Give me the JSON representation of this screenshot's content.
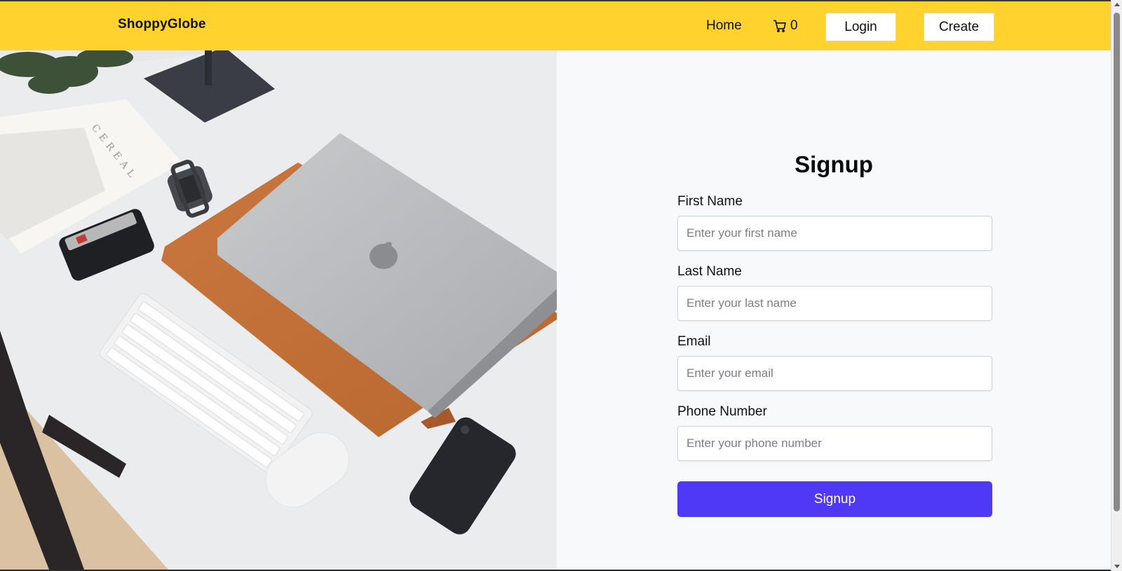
{
  "navbar": {
    "brand": "ShoppyGlobe",
    "home": "Home",
    "cart_count": "0",
    "cart_icon": "cart-icon",
    "login": "Login",
    "create": "Create",
    "background_color": "#ffd22e"
  },
  "hero": {
    "image_alt": "Desk with laptop, keyboard, mouse, phone, watch and wallet"
  },
  "form": {
    "title": "Signup",
    "fields": [
      {
        "label": "First Name",
        "placeholder": "Enter your first name"
      },
      {
        "label": "Last Name",
        "placeholder": "Enter your last name"
      },
      {
        "label": "Email",
        "placeholder": "Enter your email"
      },
      {
        "label": "Phone Number",
        "placeholder": "Enter your phone number"
      }
    ],
    "submit": "Signup",
    "submit_color": "#4f38f6"
  }
}
